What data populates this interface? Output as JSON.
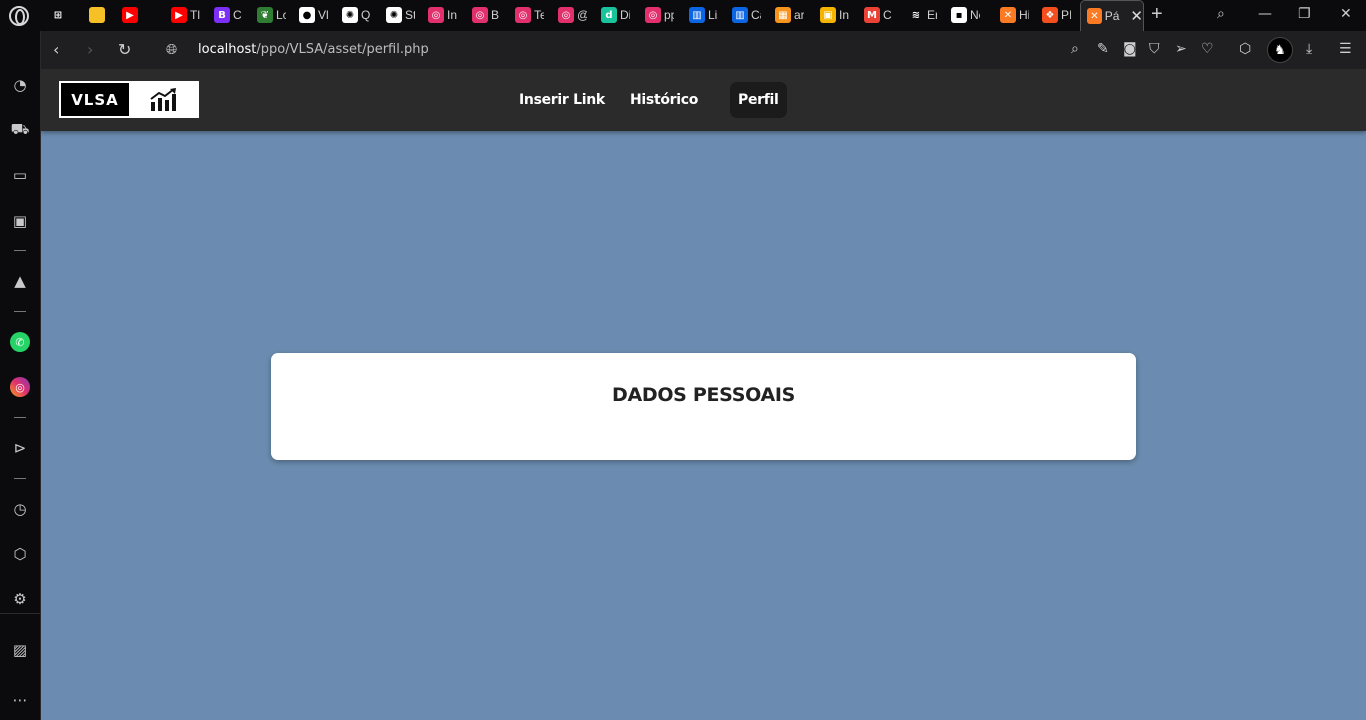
{
  "browser": {
    "tabs": [
      {
        "title": "",
        "icon": "gamepad-icon",
        "color": "#0b0b0d",
        "glyph": "⊞"
      },
      {
        "title": "",
        "icon": "keep-icon",
        "color": "#f6c026",
        "glyph": ""
      },
      {
        "title": "",
        "icon": "youtube-icon",
        "color": "#ff0000",
        "glyph": "▶"
      },
      {
        "title": "Tl",
        "icon": "youtube-icon",
        "color": "#ff0000",
        "glyph": "▶"
      },
      {
        "title": "C",
        "icon": "b-icon",
        "color": "#7b2ff7",
        "glyph": "B"
      },
      {
        "title": "Lc",
        "icon": "leaf-icon",
        "color": "#2e7d32",
        "glyph": "❦"
      },
      {
        "title": "Vl",
        "icon": "github-icon",
        "color": "#ffffff",
        "glyph": "●"
      },
      {
        "title": "Q",
        "icon": "openai-icon",
        "color": "#ffffff",
        "glyph": "✺"
      },
      {
        "title": "St",
        "icon": "openai-icon",
        "color": "#ffffff",
        "glyph": "✺"
      },
      {
        "title": "In",
        "icon": "instagram-icon",
        "color": "#e1306c",
        "glyph": "◎"
      },
      {
        "title": "B",
        "icon": "instagram-icon",
        "color": "#e1306c",
        "glyph": "◎"
      },
      {
        "title": "Te",
        "icon": "instagram-icon",
        "color": "#e1306c",
        "glyph": "◎"
      },
      {
        "title": "@",
        "icon": "instagram-icon",
        "color": "#e1306c",
        "glyph": "◎"
      },
      {
        "title": "Di",
        "icon": "d-icon",
        "color": "#19c39c",
        "glyph": "d"
      },
      {
        "title": "pp",
        "icon": "instagram-icon",
        "color": "#e1306c",
        "glyph": "◎"
      },
      {
        "title": "Lis",
        "icon": "trello-icon",
        "color": "#0c66e4",
        "glyph": "▥"
      },
      {
        "title": "Ca",
        "icon": "trello-icon",
        "color": "#0c66e4",
        "glyph": "▥"
      },
      {
        "title": "ar",
        "icon": "grid-icon",
        "color": "#f7941d",
        "glyph": "▦"
      },
      {
        "title": "In",
        "icon": "classroom-icon",
        "color": "#f4b400",
        "glyph": "▣"
      },
      {
        "title": "C",
        "icon": "gmail-icon",
        "color": "#ea4335",
        "glyph": "M"
      },
      {
        "title": "Er",
        "icon": "cisco-icon",
        "color": "#0b0b0d",
        "glyph": "≋"
      },
      {
        "title": "Ne",
        "icon": "cisco-icon",
        "color": "#ffffff",
        "glyph": "▪"
      },
      {
        "title": "Hi",
        "icon": "xampp-icon",
        "color": "#fb7a24",
        "glyph": "✕"
      },
      {
        "title": "PI",
        "icon": "figma-icon",
        "color": "#f24e1e",
        "glyph": "❖"
      }
    ],
    "active_tab": {
      "title": "Pá",
      "icon": "xampp-icon",
      "color": "#fb7a24",
      "glyph": "✕"
    },
    "url_host": "localhost",
    "url_path": "/ppo/VLSA/asset/perfil.php"
  },
  "site": {
    "logo_text": "VLSA",
    "nav": {
      "inserir_link": "Inserir Link",
      "historico": "Histórico",
      "perfil": "Perfil"
    },
    "card_title": "DADOS PESSOAIS"
  },
  "colors": {
    "page_background": "#6b8cb0",
    "header_background": "#2b2b2b",
    "active_nav_background": "#1b1b1b"
  }
}
